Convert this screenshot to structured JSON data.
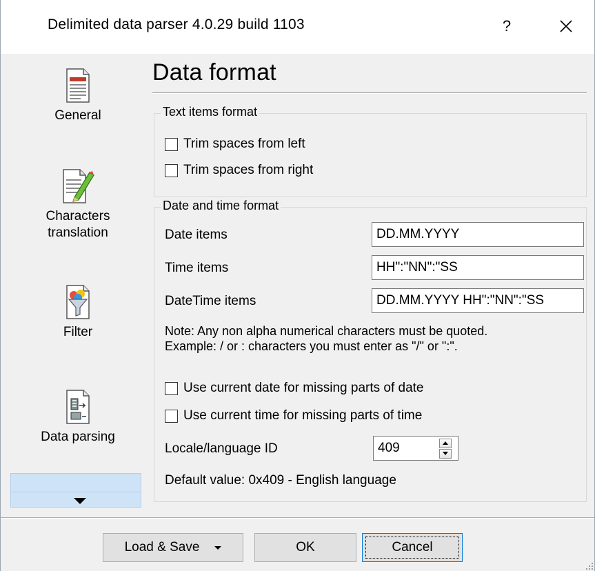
{
  "window": {
    "title": "Delimited data parser 4.0.29 build 1103",
    "help_label": "?",
    "close_icon": "close-icon"
  },
  "sidebar": {
    "items": [
      {
        "label": "General",
        "icon": "document-icon"
      },
      {
        "label": "Characters translation",
        "icon": "pencil-document-icon"
      },
      {
        "label": "Filter",
        "icon": "funnel-icon"
      },
      {
        "label": "Data parsing",
        "icon": "parsing-document-icon"
      }
    ],
    "more_icon": "chevron-down-icon"
  },
  "page": {
    "title": "Data format"
  },
  "text_items": {
    "caption": "Text items format",
    "trim_left": {
      "label": "Trim spaces from left",
      "checked": false
    },
    "trim_right": {
      "label": "Trim spaces from right",
      "checked": false
    }
  },
  "date_time": {
    "caption": "Date and time format",
    "date_items": {
      "label": "Date items",
      "value": "DD.MM.YYYY"
    },
    "time_items": {
      "label": "Time items",
      "value": "HH\":\"NN\":\"SS"
    },
    "datetime_items": {
      "label": "DateTime items",
      "value": "DD.MM.YYYY HH\":\"NN\":\"SS"
    },
    "note_line1": "Note: Any non alpha numerical characters must be quoted.",
    "note_line2": "Example: / or : characters you must enter as \"/\" or \":\".",
    "use_current_date": {
      "label": "Use current date for missing parts of date",
      "checked": false
    },
    "use_current_time": {
      "label": "Use current time for missing parts of time",
      "checked": false
    },
    "locale": {
      "label": "Locale/language ID",
      "value": "409"
    },
    "default_value": "Default value: 0x409 - English language"
  },
  "footer": {
    "load_save_label": "Load & Save",
    "ok_label": "OK",
    "cancel_label": "Cancel"
  },
  "colors": {
    "window_bg": "#f0f0f0",
    "nav_selected": "#cfe3f7",
    "focus_border": "#0078d7"
  }
}
